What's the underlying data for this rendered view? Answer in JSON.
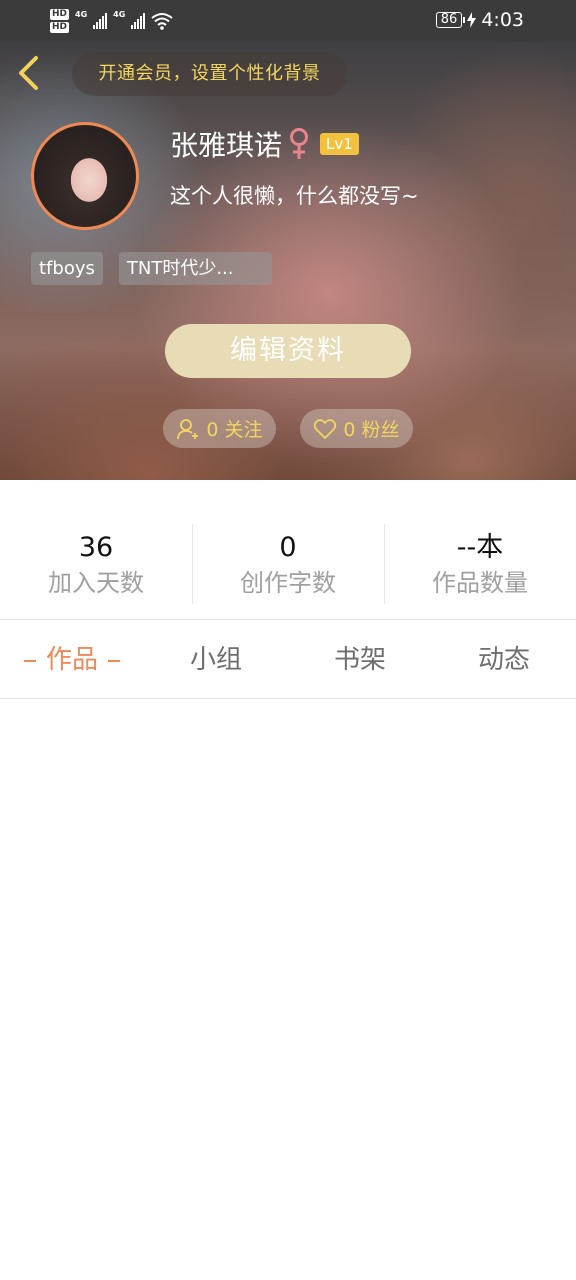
{
  "status_bar": {
    "hd1": "HD",
    "hd2": "HD",
    "net1": "4G",
    "net2": "4G",
    "battery": "86",
    "time": "4:03"
  },
  "header": {
    "vip_prompt": "开通会员，设置个性化背景",
    "username": "张雅琪诺",
    "gender": "female",
    "level": "Lv1",
    "bio": "这个人很懒，什么都没写~",
    "tags": [
      "tfboys",
      "TNT时代少..."
    ],
    "edit_button": "编辑资料",
    "follow_label": "0 关注",
    "fans_label": "0 粉丝"
  },
  "stats": [
    {
      "value": "36",
      "label": "加入天数"
    },
    {
      "value": "0",
      "label": "创作字数"
    },
    {
      "value": "--本",
      "label": "作品数量"
    }
  ],
  "tabs": [
    {
      "label": "作品",
      "active": true
    },
    {
      "label": "小组",
      "active": false
    },
    {
      "label": "书架",
      "active": false
    },
    {
      "label": "动态",
      "active": false
    }
  ],
  "colors": {
    "accent": "#ee8a55",
    "gold": "#f3d65f",
    "level_badge": "#f2c23f",
    "gender_female": "#e9838c"
  },
  "icons": {
    "back": "chevron-left-icon",
    "gender": "female-icon",
    "follow": "add-user-icon",
    "fans": "heart-icon"
  }
}
